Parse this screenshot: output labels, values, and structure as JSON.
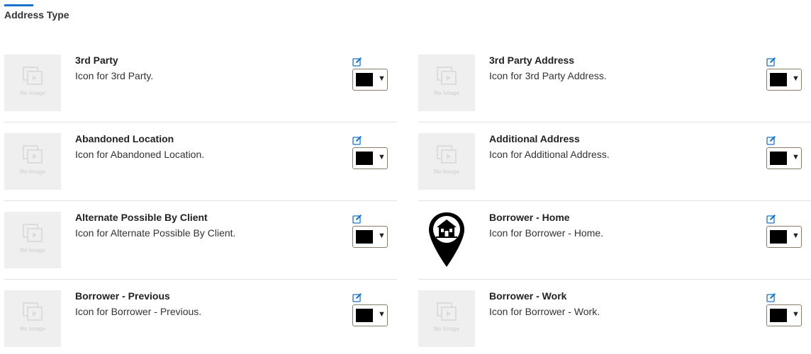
{
  "section": {
    "title": "Address Type"
  },
  "placeholder": {
    "no_image_text": "No Image"
  },
  "colors": {
    "accent": "#1a73c8",
    "swatch": "#000000",
    "thumb_bg": "#efefef",
    "divider": "#e3e3e3"
  },
  "rows": [
    [
      {
        "name": "3rd Party",
        "description": "Icon for 3rd Party.",
        "icon": "no-image",
        "color": "#000000"
      },
      {
        "name": "3rd Party Address",
        "description": "Icon for 3rd Party Address.",
        "icon": "no-image",
        "color": "#000000"
      }
    ],
    [
      {
        "name": "Abandoned Location",
        "description": "Icon for Abandoned Location.",
        "icon": "no-image",
        "color": "#000000"
      },
      {
        "name": "Additional Address",
        "description": "Icon for Additional Address.",
        "icon": "no-image",
        "color": "#000000"
      }
    ],
    [
      {
        "name": "Alternate Possible By Client",
        "description": "Icon for Alternate Possible By Client.",
        "icon": "no-image",
        "color": "#000000"
      },
      {
        "name": "Borrower - Home",
        "description": "Icon for Borrower - Home.",
        "icon": "map-pin-house",
        "color": "#000000"
      }
    ],
    [
      {
        "name": "Borrower - Previous",
        "description": "Icon for Borrower - Previous.",
        "icon": "no-image",
        "color": "#000000"
      },
      {
        "name": "Borrower - Work",
        "description": "Icon for Borrower - Work.",
        "icon": "no-image",
        "color": "#000000"
      }
    ]
  ]
}
